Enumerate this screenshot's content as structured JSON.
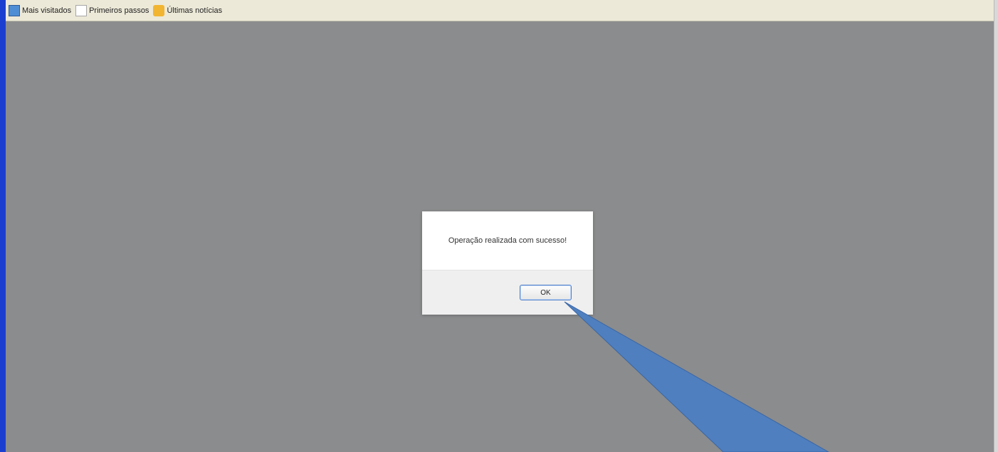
{
  "bookmarks": [
    {
      "label": "Mais visitados",
      "icon": "most-visited-icon"
    },
    {
      "label": "Primeiros passos",
      "icon": "blank-page-icon"
    },
    {
      "label": "Últimas notícias",
      "icon": "rss-feed-icon"
    }
  ],
  "dialog": {
    "message": "Operação realizada com sucesso!",
    "ok_label": "OK"
  },
  "colors": {
    "overlay": "#8b8c8d",
    "arrow_fill": "#4f7fbf",
    "arrow_stroke": "#3a66a4"
  }
}
